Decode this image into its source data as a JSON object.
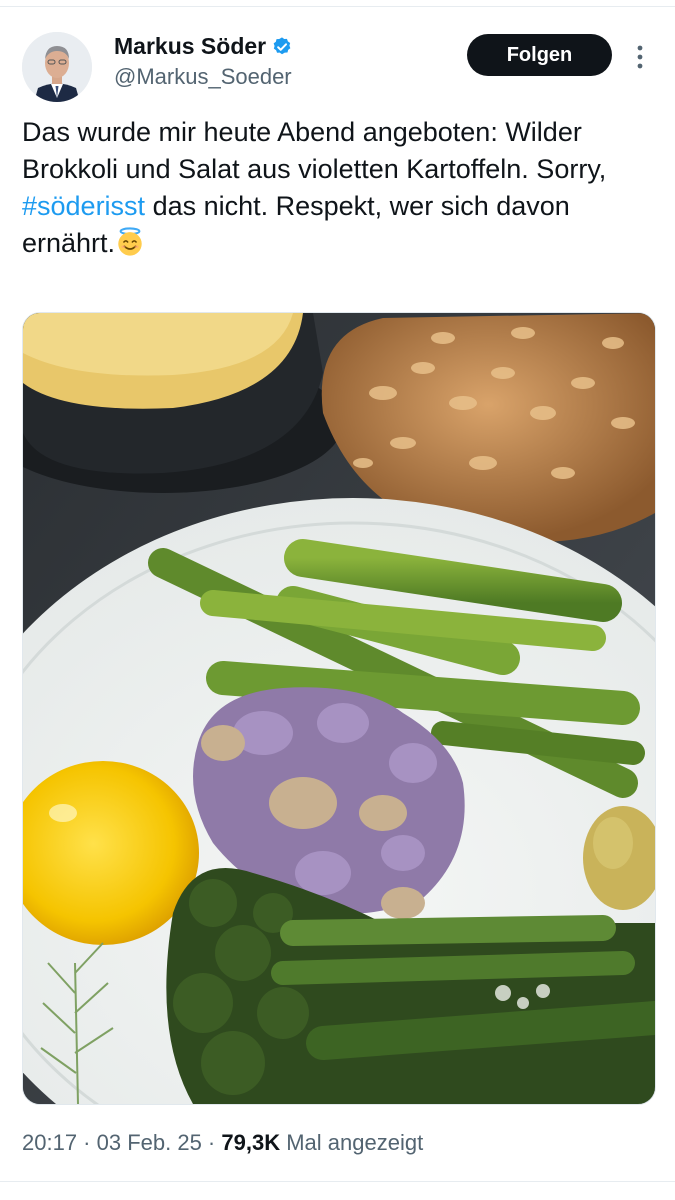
{
  "tweet": {
    "author": {
      "display_name": "Markus Söder",
      "handle": "@Markus_Soeder",
      "verified": true
    },
    "follow_label": "Folgen",
    "text_before": "Das wurde mir heute Abend angeboten: Wilder Brokkoli und Salat aus violetten Kartoffeln. Sorry, ",
    "hashtag": "#söderisst",
    "text_after": " das nicht. Respekt, wer sich davon ernährt.",
    "emoji": "smiling-face-with-halo",
    "meta": {
      "time": "20:17",
      "sep1": " · ",
      "date": "03 Feb. 25",
      "sep2": " · ",
      "views": "79,3K",
      "views_suffix": " Mal angezeigt"
    }
  },
  "colors": {
    "accent": "#1d9bf0",
    "verified": "#1d9bf0",
    "text": "#0f1419",
    "secondary": "#536471"
  },
  "icons": [
    "verified-badge-icon",
    "more-options-icon"
  ]
}
